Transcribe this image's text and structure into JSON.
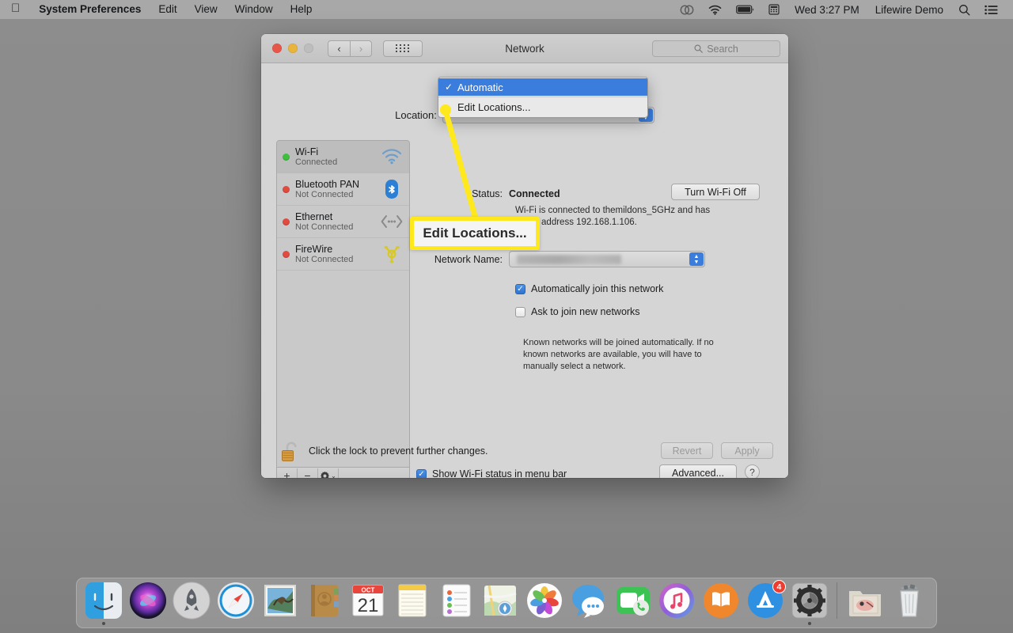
{
  "menubar": {
    "apple_icon": "apple-logo-icon",
    "items": [
      {
        "label": "System Preferences",
        "bold": true
      },
      {
        "label": "Edit",
        "bold": false
      },
      {
        "label": "View",
        "bold": false
      },
      {
        "label": "Window",
        "bold": false
      },
      {
        "label": "Help",
        "bold": false
      }
    ],
    "status_icons": [
      "creative-cloud-icon",
      "wifi-icon",
      "battery-icon",
      "calculator-icon"
    ],
    "clock": "Wed 3:27 PM",
    "user": "Lifewire Demo",
    "search_icon": "spotlight-search-icon",
    "control_center_icon": "notification-center-icon"
  },
  "window": {
    "title": "Network",
    "traffic_lights": [
      "close-button",
      "minimize-button",
      "zoom-button"
    ],
    "nav_back": "‹",
    "nav_forward": "›",
    "grid_button": "show-all-preferences-button",
    "search_placeholder": "Search"
  },
  "location": {
    "label": "Location:",
    "selected": "Automatic",
    "menu_open": true,
    "options": [
      {
        "label": "Automatic",
        "checked": true
      },
      {
        "label": "Edit Locations...",
        "checked": false
      }
    ]
  },
  "sidebar": {
    "services": [
      {
        "name": "Wi-Fi",
        "state": "Connected",
        "dot": "green",
        "icon": "wifi-icon",
        "active": true
      },
      {
        "name": "Bluetooth PAN",
        "state": "Not Connected",
        "dot": "red",
        "icon": "bluetooth-icon",
        "active": false
      },
      {
        "name": "Ethernet",
        "state": "Not Connected",
        "dot": "red",
        "icon": "ethernet-icon",
        "active": false
      },
      {
        "name": "FireWire",
        "state": "Not Connected",
        "dot": "red",
        "icon": "firewire-icon",
        "active": false
      }
    ],
    "toolbar": {
      "add": "+",
      "remove": "−",
      "gear": "⚙",
      "gear_chevron": "⌄"
    }
  },
  "detail": {
    "status_label": "Status:",
    "status_value": "Connected",
    "turn_off_button": "Turn Wi-Fi Off",
    "status_description": "Wi-Fi is connected to themildons_5GHz and has the IP address 192.168.1.106.",
    "network_name_label": "Network Name:",
    "network_name_value": "",
    "checkbox_auto_join": {
      "label": "Automatically join this network",
      "checked": true
    },
    "checkbox_ask_join": {
      "label": "Ask to join new networks",
      "checked": false
    },
    "join_description": "Known networks will be joined automatically. If no known networks are available, you will have to manually select a network.",
    "checkbox_menu_bar": {
      "label": "Show Wi-Fi status in menu bar",
      "checked": true
    },
    "advanced_button": "Advanced...",
    "help_button": "?"
  },
  "footer": {
    "lock_icon": "unlocked-padlock-icon",
    "lock_text": "Click the lock to prevent further changes.",
    "revert_button": "Revert",
    "apply_button": "Apply"
  },
  "annotation": {
    "callout_text": "Edit Locations...",
    "highlight_color": "#ffe81c"
  },
  "dock": {
    "items": [
      {
        "name": "finder",
        "running": true
      },
      {
        "name": "siri",
        "running": false
      },
      {
        "name": "launchpad",
        "running": false
      },
      {
        "name": "safari",
        "running": false
      },
      {
        "name": "mail",
        "running": false
      },
      {
        "name": "contacts",
        "running": false
      },
      {
        "name": "calendar",
        "running": false,
        "label_top": "OCT",
        "label_day": "21"
      },
      {
        "name": "notes",
        "running": false
      },
      {
        "name": "reminders",
        "running": false
      },
      {
        "name": "maps",
        "running": false
      },
      {
        "name": "photos",
        "running": false
      },
      {
        "name": "messages",
        "running": false
      },
      {
        "name": "facetime",
        "running": false
      },
      {
        "name": "itunes",
        "running": false
      },
      {
        "name": "books",
        "running": false
      },
      {
        "name": "app-store",
        "running": false,
        "badge": "4"
      },
      {
        "name": "system-preferences",
        "running": true
      }
    ],
    "right_items": [
      {
        "name": "downloads-folder"
      },
      {
        "name": "trash"
      }
    ]
  }
}
